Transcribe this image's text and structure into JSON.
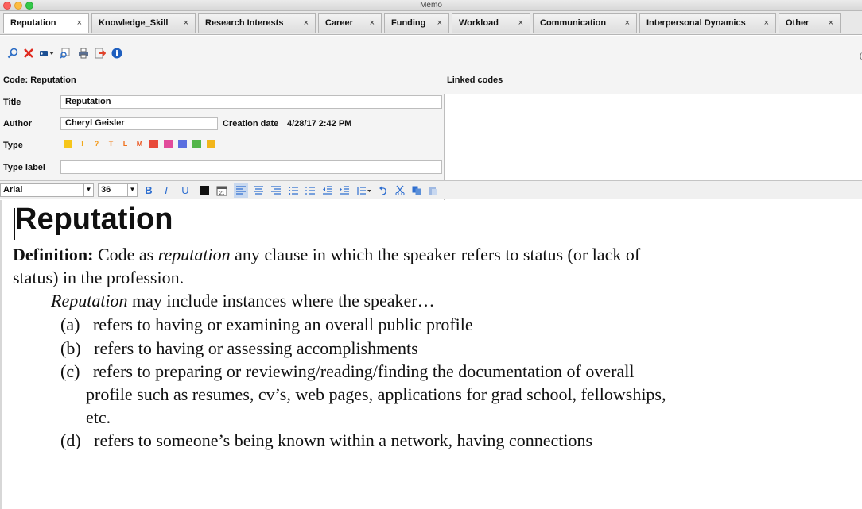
{
  "window": {
    "title": "Memo"
  },
  "tabs": [
    {
      "label": "Reputation",
      "close": "×"
    },
    {
      "label": "Knowledge_Skill",
      "close": "×"
    },
    {
      "label": "Research Interests",
      "close": "×"
    },
    {
      "label": "Career",
      "close": "×"
    },
    {
      "label": "Funding",
      "close": "×"
    },
    {
      "label": "Workload",
      "close": "×"
    },
    {
      "label": "Communication",
      "close": "×"
    },
    {
      "label": "Interpersonal Dynamics",
      "close": "×"
    },
    {
      "label": "Other",
      "close": "×"
    }
  ],
  "toolbar": {
    "icons": [
      "search-icon",
      "delete-icon",
      "tag-dropdown-icon",
      "print-preview-icon",
      "print-icon",
      "export-icon",
      "info-icon"
    ]
  },
  "memo": {
    "code_label": "Code: Reputation",
    "linked_codes_label": "Linked codes",
    "title_label": "Title",
    "title_value": "Reputation",
    "author_label": "Author",
    "author_value": "Cheryl Geisler",
    "creation_date_label": "Creation date",
    "creation_date_value": "4/28/17 2:42 PM",
    "type_label": "Type",
    "type_label_label": "Type label",
    "type_label_value": "",
    "type_swatches": [
      {
        "glyph": "",
        "color": "#f6c61b"
      },
      {
        "glyph": "!",
        "color": "#f0a81a"
      },
      {
        "glyph": "?",
        "color": "#f39a1a"
      },
      {
        "glyph": "T",
        "color": "#f07d18"
      },
      {
        "glyph": "L",
        "color": "#f0701b"
      },
      {
        "glyph": "M",
        "color": "#ec5a24"
      },
      {
        "glyph": "",
        "color": "#e84a3a"
      },
      {
        "glyph": "",
        "color": "#e24b9b"
      },
      {
        "glyph": "",
        "color": "#5b6fe0"
      },
      {
        "glyph": "",
        "color": "#53b54a"
      },
      {
        "glyph": "",
        "color": "#f2b51a"
      }
    ]
  },
  "format": {
    "font_family": "Arial",
    "font_size": "36",
    "bold": "B",
    "italic": "I",
    "underline": "U"
  },
  "document": {
    "heading": "Reputation",
    "definition_label": "Definition:",
    "def_part1": "Code as",
    "def_italic": "reputation",
    "def_part2": "any clause in which the speaker refers to status (or lack of",
    "def_line2": "status) in the profession.",
    "intro_italic": "Reputation",
    "intro_rest": "may include instances where the speaker…",
    "items": [
      {
        "marker": "(a)",
        "text": "refers to having or examining an overall public profile"
      },
      {
        "marker": "(b)",
        "text": "refers to having or assessing  accomplishments"
      },
      {
        "marker": "(c)",
        "text": "refers to preparing or reviewing/reading/finding the documentation of overall"
      },
      {
        "marker": "(d)",
        "text": "refers to someone’s being known within a network, having connections"
      }
    ],
    "item_c_line2": "profile such as resumes, cv’s, web pages, applications for grad school, fellowships,",
    "item_c_line3": "etc."
  }
}
